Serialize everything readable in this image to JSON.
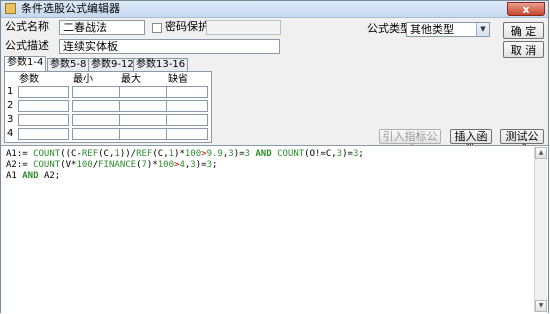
{
  "window": {
    "title": "条件选股公式编辑器",
    "close_glyph": "x"
  },
  "form": {
    "name_label": "公式名称",
    "name_value": "二春战法",
    "password_label": "密码保护",
    "password_value": "",
    "desc_label": "公式描述",
    "desc_value": "连续实体板",
    "type_label": "公式类型",
    "type_value": "其他类型"
  },
  "buttons": {
    "ok": "确 定",
    "cancel": "取 消",
    "import_indicator": "引入指标公式",
    "insert_function": "插入函数",
    "test_formula": "测试公式"
  },
  "tabs": [
    "参数1-4",
    "参数5-8",
    "参数9-12",
    "参数13-16"
  ],
  "params": {
    "headers": [
      "参数",
      "最小",
      "最大",
      "缺省"
    ],
    "rows": [
      "1",
      "2",
      "3",
      "4"
    ]
  },
  "code": {
    "lines": [
      [
        [
          "id",
          "A1:= "
        ],
        [
          "fn",
          "COUNT"
        ],
        [
          "id",
          "(("
        ],
        [
          "id",
          "C-"
        ],
        [
          "fn",
          "REF"
        ],
        [
          "id",
          "(C,"
        ],
        [
          "num",
          "1"
        ],
        [
          "id",
          "))/"
        ],
        [
          "fn",
          "REF"
        ],
        [
          "id",
          "(C,"
        ],
        [
          "num",
          "1"
        ],
        [
          "id",
          ")*"
        ],
        [
          "num",
          "100"
        ],
        [
          "op",
          ">"
        ],
        [
          "num",
          "9.9"
        ],
        [
          "id",
          ","
        ],
        [
          "num",
          "3"
        ],
        [
          "id",
          ")="
        ],
        [
          "num",
          "3"
        ],
        [
          "id",
          " "
        ],
        [
          "kw",
          "AND"
        ],
        [
          "id",
          " "
        ],
        [
          "fn",
          "COUNT"
        ],
        [
          "id",
          "(O!=C,"
        ],
        [
          "num",
          "3"
        ],
        [
          "id",
          ")="
        ],
        [
          "num",
          "3"
        ],
        [
          "id",
          ";"
        ]
      ],
      [
        [
          "id",
          "A2:= "
        ],
        [
          "fn",
          "COUNT"
        ],
        [
          "id",
          "(V*"
        ],
        [
          "num",
          "100"
        ],
        [
          "id",
          "/"
        ],
        [
          "fn",
          "FINANCE"
        ],
        [
          "id",
          "("
        ],
        [
          "num",
          "7"
        ],
        [
          "id",
          ")*"
        ],
        [
          "num",
          "100"
        ],
        [
          "op",
          ">"
        ],
        [
          "num",
          "4"
        ],
        [
          "id",
          ","
        ],
        [
          "num",
          "3"
        ],
        [
          "id",
          ")="
        ],
        [
          "num",
          "3"
        ],
        [
          "id",
          ";"
        ]
      ],
      [
        [
          "id",
          "A1 "
        ],
        [
          "kw",
          "AND"
        ],
        [
          "id",
          " A2;"
        ]
      ]
    ]
  },
  "scrollbar": {
    "up_glyph": "▲",
    "down_glyph": "▼"
  },
  "select_arrow_glyph": "▼"
}
